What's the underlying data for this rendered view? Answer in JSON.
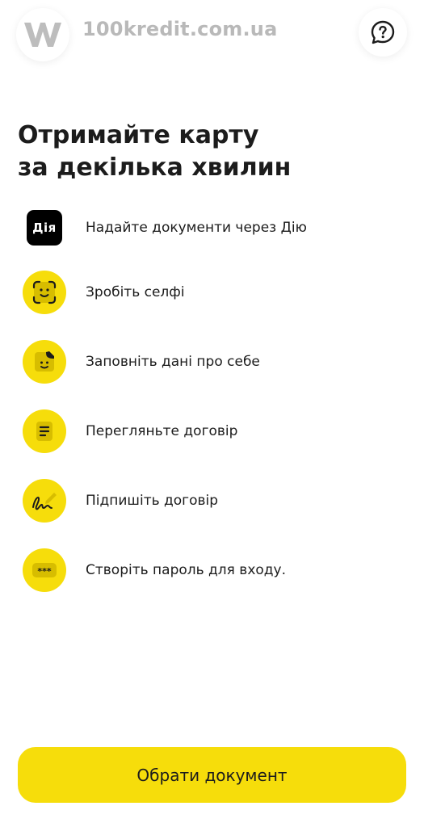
{
  "header": {
    "watermark": "100kredit.com.ua",
    "logo_icon": "w-logo-icon",
    "help_icon": "question-chat-icon"
  },
  "title": {
    "line1": "Отримайте карту",
    "line2": "за декілька хвилин"
  },
  "steps": [
    {
      "icon": "diia-icon",
      "icon_text": "Дія",
      "label": "Надайте документи через Дію"
    },
    {
      "icon": "face-scan-icon",
      "label": "Зробіть селфі"
    },
    {
      "icon": "profile-face-icon",
      "label": "Заповніть дані про себе"
    },
    {
      "icon": "document-icon",
      "label": "Перегляньте договір"
    },
    {
      "icon": "signature-icon",
      "label": "Підпишіть договір"
    },
    {
      "icon": "password-icon",
      "label": "Створіть пароль для входу."
    }
  ],
  "cta": {
    "label": "Обрати документ"
  },
  "colors": {
    "accent": "#f6dd0b",
    "text": "#1c1c1c",
    "background": "#ffffff"
  }
}
